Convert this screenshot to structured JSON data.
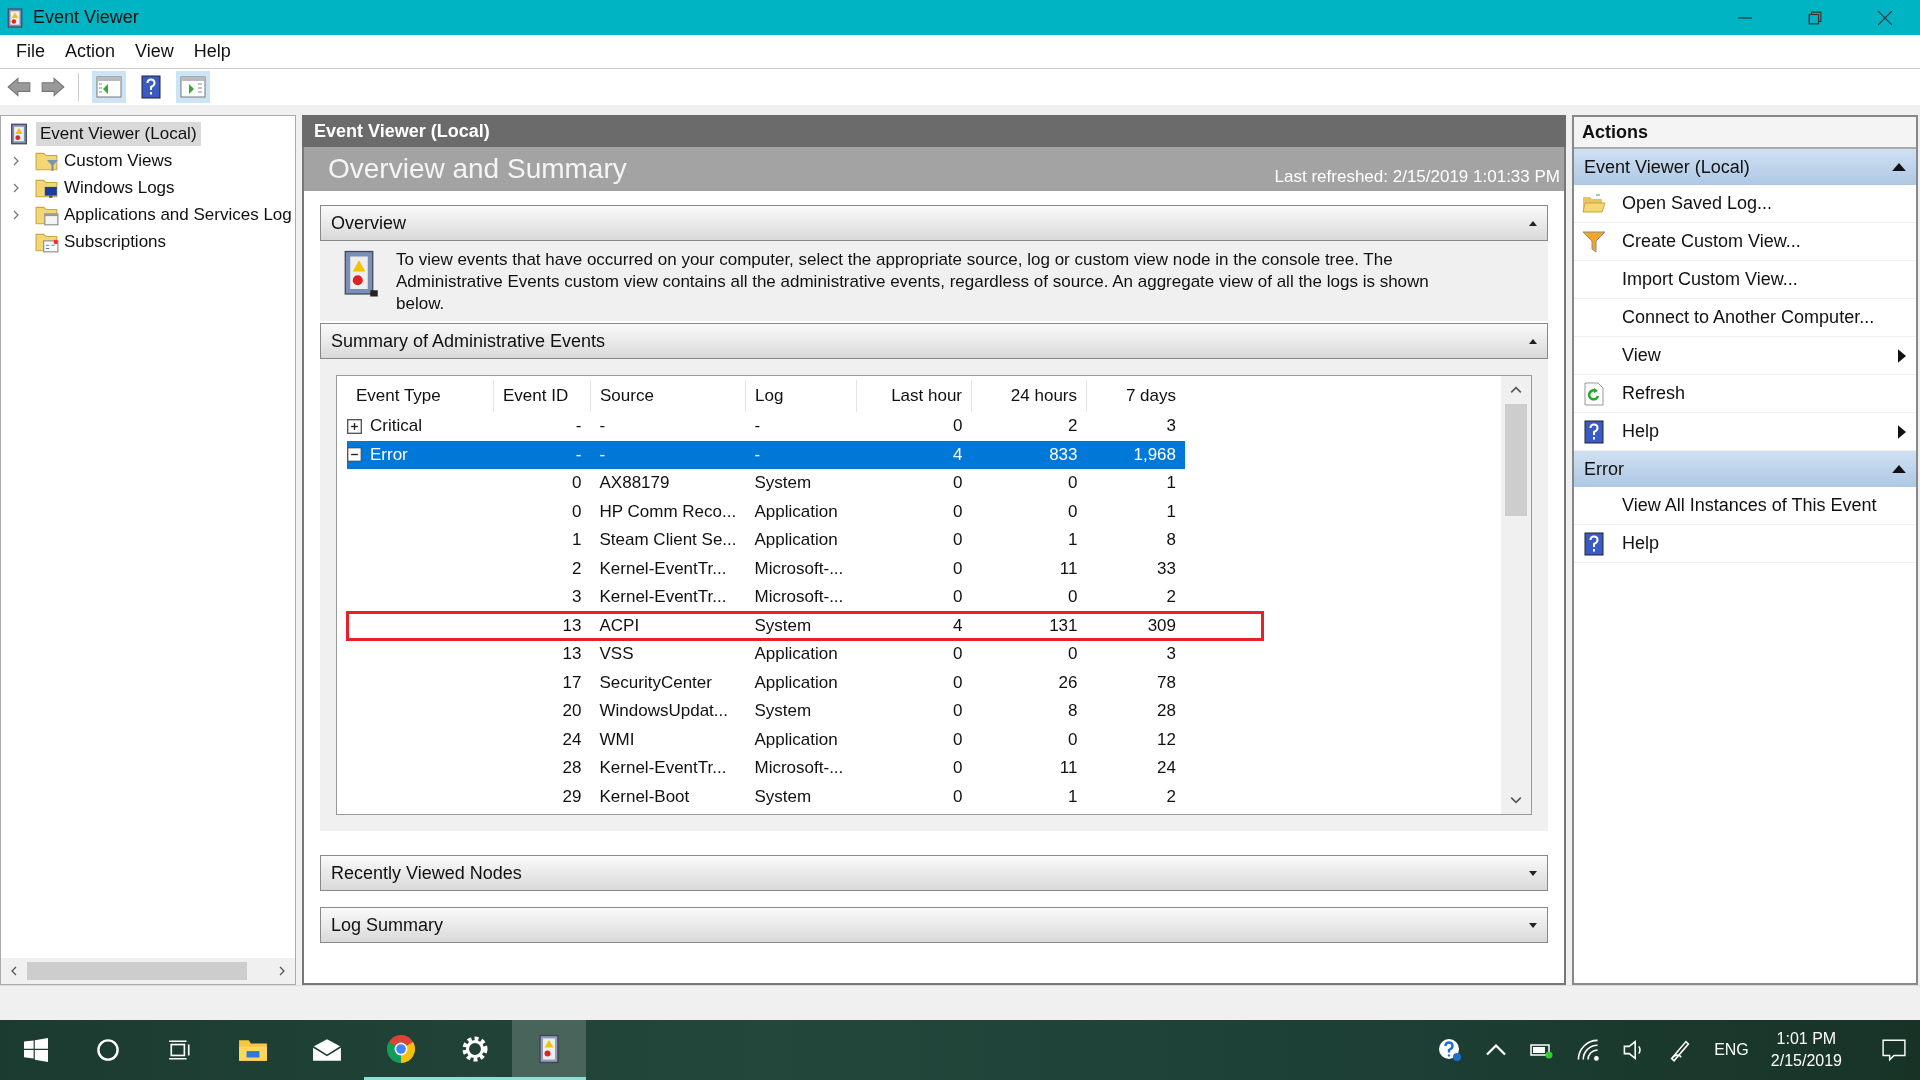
{
  "window": {
    "title": "Event Viewer"
  },
  "menu": [
    "File",
    "Action",
    "View",
    "Help"
  ],
  "tree": [
    {
      "label": "Event Viewer (Local)",
      "selected": true,
      "children": [
        {
          "label": "Custom Views",
          "kind": "filter",
          "selected": false,
          "expanded": false
        },
        {
          "label": "Windows Logs",
          "kind": "monitor",
          "selected": false,
          "expanded": false
        },
        {
          "label": "Applications and Services Log",
          "kind": "window",
          "selected": false,
          "expanded": false
        },
        {
          "label": "Subscriptions",
          "kind": "subscriptions",
          "selected": false
        }
      ]
    }
  ],
  "center": {
    "header": "Event Viewer (Local)",
    "title": "Overview and Summary",
    "refreshed": "Last refreshed: 2/15/2019 1:01:33 PM",
    "sections": [
      {
        "title": "Overview",
        "expanded": true,
        "kind": "text",
        "text": "To view events that have occurred on your computer, select the appropriate source, log or custom view node in the console tree. The Administrative Events custom view contains all the administrative events, regardless of source. An aggregate view of all the logs is shown below."
      },
      {
        "title": "Summary of Administrative Events",
        "expanded": true,
        "kind": "table"
      },
      {
        "title": "Recently Viewed Nodes",
        "expanded": false
      },
      {
        "title": "Log Summary",
        "expanded": false
      }
    ]
  },
  "table": {
    "columns": [
      "Event Type",
      "Event ID",
      "Source",
      "Log",
      "Last hour",
      "24 hours",
      "7 days"
    ],
    "rows": [
      {
        "kind": "group",
        "cells": [
          "Critical",
          "-",
          "-",
          "-",
          "0",
          "2",
          "3"
        ],
        "expanded": false,
        "selected": false,
        "annotated": false
      },
      {
        "kind": "group",
        "cells": [
          "Error",
          "-",
          "-",
          "-",
          "4",
          "833",
          "1,968"
        ],
        "expanded": true,
        "selected": true,
        "annotated": false
      },
      {
        "kind": "event",
        "cells": [
          "",
          "0",
          "AX88179",
          "System",
          "0",
          "0",
          "1"
        ],
        "selected": false,
        "annotated": false
      },
      {
        "kind": "event",
        "cells": [
          "",
          "0",
          "HP Comm Reco...",
          "Application",
          "0",
          "0",
          "1"
        ],
        "selected": false,
        "annotated": false
      },
      {
        "kind": "event",
        "cells": [
          "",
          "1",
          "Steam Client Se...",
          "Application",
          "0",
          "1",
          "8"
        ],
        "selected": false,
        "annotated": false
      },
      {
        "kind": "event",
        "cells": [
          "",
          "2",
          "Kernel-EventTr...",
          "Microsoft-...",
          "0",
          "11",
          "33"
        ],
        "selected": false,
        "annotated": false
      },
      {
        "kind": "event",
        "cells": [
          "",
          "3",
          "Kernel-EventTr...",
          "Microsoft-...",
          "0",
          "0",
          "2"
        ],
        "selected": false,
        "annotated": false
      },
      {
        "kind": "event",
        "cells": [
          "",
          "13",
          "ACPI",
          "System",
          "4",
          "131",
          "309"
        ],
        "selected": false,
        "annotated": true
      },
      {
        "kind": "event",
        "cells": [
          "",
          "13",
          "VSS",
          "Application",
          "0",
          "0",
          "3"
        ],
        "selected": false,
        "annotated": false
      },
      {
        "kind": "event",
        "cells": [
          "",
          "17",
          "SecurityCenter",
          "Application",
          "0",
          "26",
          "78"
        ],
        "selected": false,
        "annotated": false
      },
      {
        "kind": "event",
        "cells": [
          "",
          "20",
          "WindowsUpdat...",
          "System",
          "0",
          "8",
          "28"
        ],
        "selected": false,
        "annotated": false
      },
      {
        "kind": "event",
        "cells": [
          "",
          "24",
          "WMI",
          "Application",
          "0",
          "0",
          "12"
        ],
        "selected": false,
        "annotated": false
      },
      {
        "kind": "event",
        "cells": [
          "",
          "28",
          "Kernel-EventTr...",
          "Microsoft-...",
          "0",
          "11",
          "24"
        ],
        "selected": false,
        "annotated": false
      },
      {
        "kind": "event",
        "cells": [
          "",
          "29",
          "Kernel-Boot",
          "System",
          "0",
          "1",
          "2"
        ],
        "selected": false,
        "annotated": false
      }
    ]
  },
  "actions": {
    "title": "Actions",
    "groups": [
      {
        "title": "Event Viewer (Local)",
        "expanded": true,
        "items": [
          {
            "label": "Open Saved Log...",
            "kind": "open",
            "submenu": false
          },
          {
            "label": "Create Custom View...",
            "kind": "create",
            "submenu": false
          },
          {
            "label": "Import Custom View...",
            "kind": "plain",
            "submenu": false
          },
          {
            "label": "Connect to Another Computer...",
            "kind": "plain",
            "submenu": false
          },
          {
            "label": "View",
            "kind": "plain",
            "submenu": true
          },
          {
            "label": "Refresh",
            "kind": "refresh",
            "submenu": false
          },
          {
            "label": "Help",
            "kind": "help",
            "submenu": true
          }
        ]
      },
      {
        "title": "Error",
        "expanded": true,
        "items": [
          {
            "label": "View All Instances of This Event",
            "kind": "plain",
            "submenu": false
          },
          {
            "label": "Help",
            "kind": "help",
            "submenu": false
          }
        ]
      }
    ]
  },
  "taskbar": {
    "apps": [
      {
        "kind": "files",
        "running": false,
        "selected": false
      },
      {
        "kind": "mail",
        "running": false,
        "selected": false
      },
      {
        "kind": "browser",
        "running": true,
        "selected": false
      },
      {
        "kind": "settings",
        "running": true,
        "selected": false
      },
      {
        "kind": "eventviewer",
        "running": true,
        "selected": true
      }
    ],
    "language": "ENG",
    "time": "1:01 PM",
    "date": "2/15/2019"
  }
}
